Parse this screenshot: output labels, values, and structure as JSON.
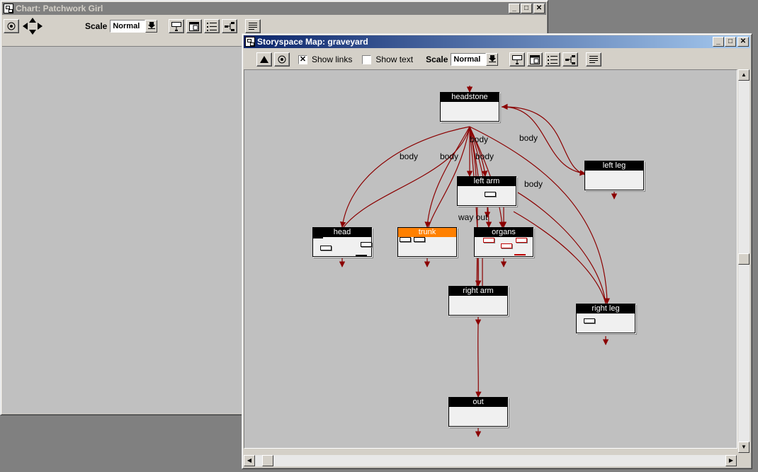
{
  "chart_window": {
    "title": "Chart: Patchwork Girl",
    "scale_label": "Scale",
    "scale_value": "Normal"
  },
  "map_window": {
    "title": "Storyspace Map: graveyard",
    "show_links_label": "Show links",
    "show_links_checked": "✕",
    "show_text_label": "Show text",
    "scale_label": "Scale",
    "scale_value": "Normal"
  },
  "window_buttons": {
    "minimize": "_",
    "maximize": "□",
    "close": "✕"
  },
  "nodes": {
    "headstone": "headstone",
    "left_leg": "left leg",
    "left_arm": "left arm",
    "head": "head",
    "trunk": "trunk",
    "organs": "organs",
    "right_arm": "right arm",
    "right_leg": "right leg",
    "out": "out"
  },
  "link_labels": {
    "body_left": "body",
    "body_mid": "body",
    "body_center": "body",
    "body_right": "body",
    "body_top": "body",
    "body_leftleg": "body",
    "body_rightleg": "body",
    "way_out": "way out"
  },
  "colors": {
    "link": "#8b0000",
    "trunk_title": "#ff8000",
    "active_title": "#0a246a"
  }
}
